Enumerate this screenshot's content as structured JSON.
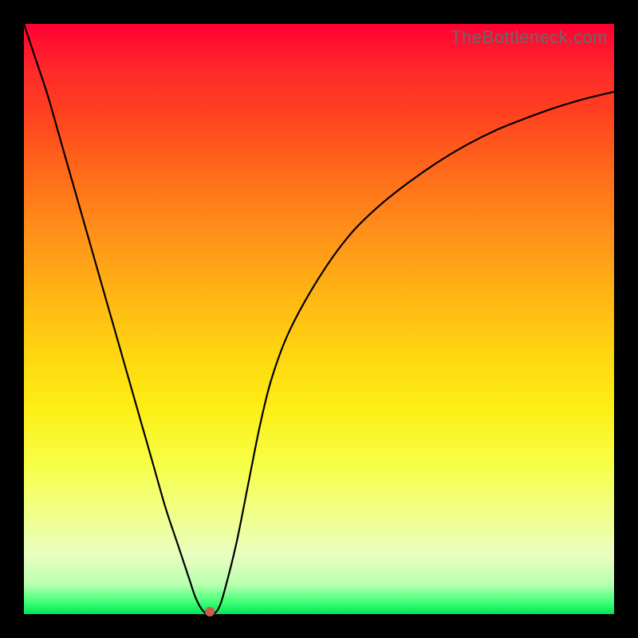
{
  "watermark": "TheBottleneck.com",
  "colors": {
    "curve": "#000000",
    "marker": "#cf5a48",
    "frame": "#000000"
  },
  "chart_data": {
    "type": "line",
    "title": "",
    "xlabel": "",
    "ylabel": "",
    "xlim": [
      0,
      100
    ],
    "ylim": [
      0,
      100
    ],
    "grid": false,
    "series": [
      {
        "name": "bottleneck-curve",
        "x": [
          0,
          2,
          4,
          6,
          8,
          10,
          12,
          14,
          16,
          18,
          20,
          22,
          24,
          26,
          28,
          29,
          30,
          31,
          32,
          33,
          34,
          36,
          38,
          40,
          42,
          45,
          50,
          55,
          60,
          65,
          70,
          75,
          80,
          85,
          90,
          95,
          100
        ],
        "values": [
          100,
          94,
          88,
          81,
          74,
          67,
          60,
          53,
          46,
          39,
          32,
          25,
          18,
          12,
          6,
          3,
          1,
          0,
          0,
          1,
          4,
          12,
          22,
          32,
          40,
          48,
          57,
          64,
          69,
          73,
          76.5,
          79.5,
          82,
          84,
          85.8,
          87.3,
          88.5
        ]
      }
    ],
    "marker": {
      "x": 31.5,
      "y": 0
    }
  }
}
